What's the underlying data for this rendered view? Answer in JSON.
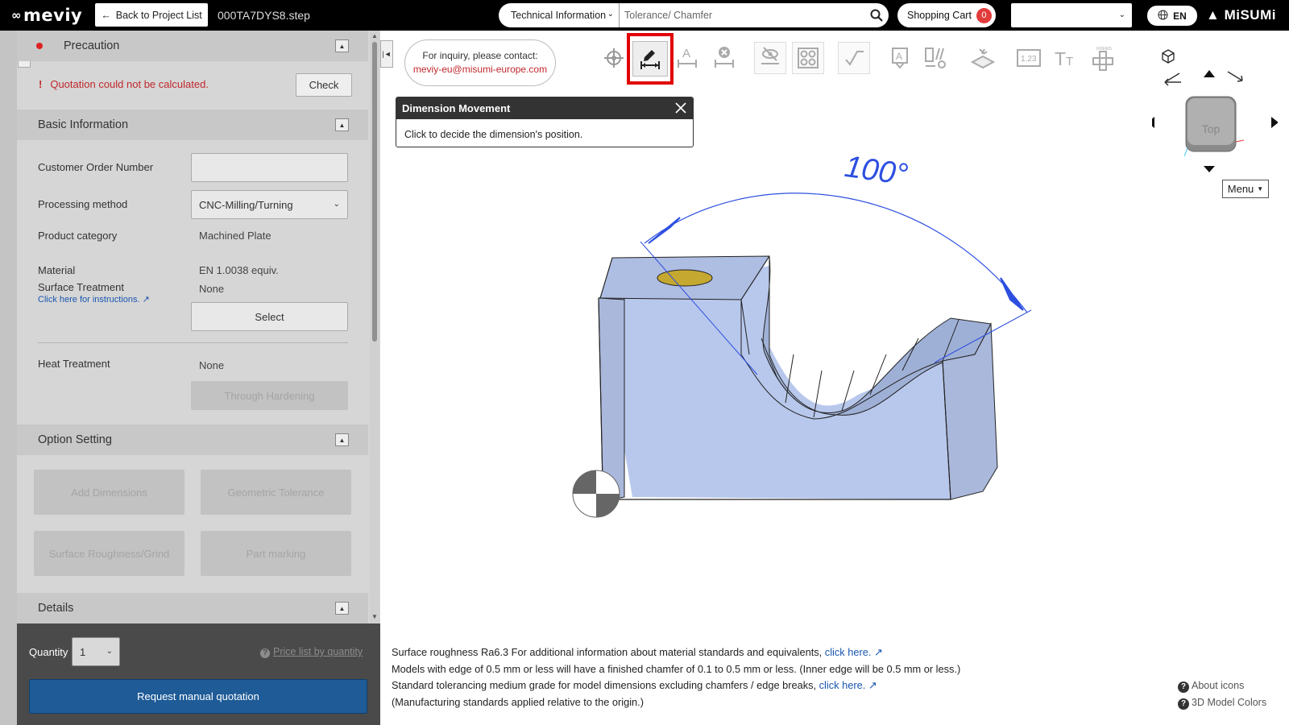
{
  "header": {
    "logo": "meviy",
    "back_label": "Back to Project List",
    "filename": "000TA7DYS8.step",
    "search_category": "Technical Information",
    "search_placeholder": "Tolerance/ Chamfer",
    "cart_label": "Shopping Cart",
    "cart_count": "0",
    "lang": "EN",
    "brand": "MiSUMi"
  },
  "precaution": {
    "title": "Precaution",
    "warning": "Quotation could not be calculated.",
    "check_label": "Check"
  },
  "basic_info": {
    "title": "Basic Information",
    "customer_order_label": "Customer Order Number",
    "customer_order_value": "",
    "processing_label": "Processing method",
    "processing_value": "CNC-Milling/Turning",
    "category_label": "Product category",
    "category_value": "Machined Plate",
    "material_label": "Material",
    "material_value": "EN 1.0038 equiv.",
    "surface_label": "Surface Treatment",
    "surface_value": "None",
    "instructions_link": "Click here for instructions.",
    "select_label": "Select",
    "heat_label": "Heat Treatment",
    "heat_value": "None",
    "hardening_label": "Through Hardening"
  },
  "option_setting": {
    "title": "Option Setting",
    "buttons": [
      "Add Dimensions",
      "Geometric Tolerance",
      "Surface Roughness/Grind",
      "Part marking"
    ]
  },
  "details": {
    "title": "Details"
  },
  "footer": {
    "quantity_label": "Quantity",
    "quantity_value": "1",
    "price_link": "Price list by quantity",
    "request_label": "Request manual quotation"
  },
  "viewer": {
    "inquiry_line1": "For inquiry, please contact:",
    "inquiry_mail": "meviy-eu@misumi-europe.com",
    "popup_title": "Dimension Movement",
    "popup_body": "Click to decide the dimension's position.",
    "dimension_label": "100°",
    "navcube_face": "Top",
    "menu_label": "Menu",
    "toolbar_icons": [
      "origin-icon",
      "dimension-move-icon",
      "dimension-text-icon",
      "dimension-delete-icon",
      "hide-dimension-icon",
      "hole-pattern-icon",
      "surface-roughness-icon",
      "text-annotation-icon",
      "geometric-tolerance-icon",
      "part-marking-icon",
      "numbering-icon",
      "font-size-icon",
      "views-icon"
    ]
  },
  "notes": {
    "line1": "Surface roughness Ra6.3    For additional information about material standards and equivalents,",
    "line1_link": "click here.",
    "line2": "Models with edge of 0.5 mm or less will have a finished chamfer of 0.1 to 0.5 mm or less. (Inner edge will be 0.5 mm or less.)",
    "line3": "Standard tolerancing medium grade for model dimensions excluding chamfers / edge breaks,",
    "line3_link": "click here.",
    "line4": "(Manufacturing standards applied relative to the origin.)"
  },
  "help": {
    "about_icons": "About icons",
    "model_colors": "3D Model Colors"
  },
  "colors": {
    "accent_blue": "#1e5b97",
    "alert_red": "#c0282d",
    "model_fill": "#b8c8ec",
    "dimension_blue": "#2d4fe0"
  }
}
